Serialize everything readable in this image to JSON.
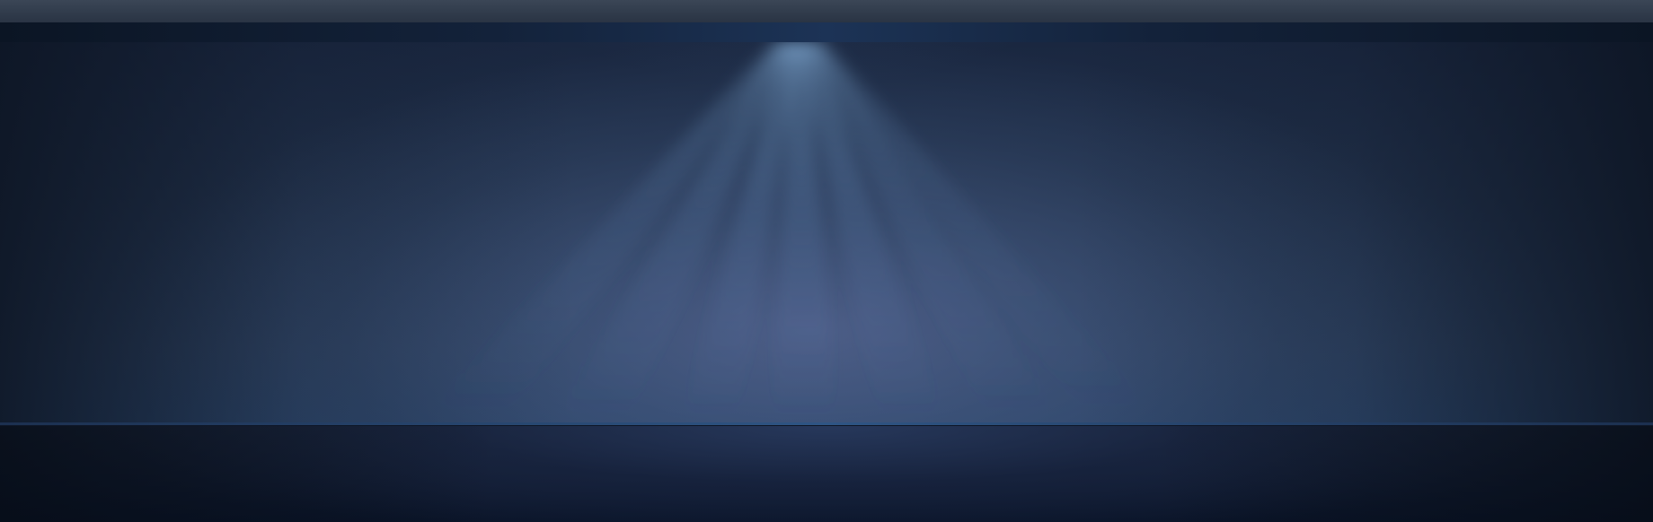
{
  "scene": {
    "name": "spotlight-stage-background",
    "colors": {
      "top_bar": "#333e4e",
      "header_strip": "#13223a",
      "stage_base": "#22324c",
      "spotlight": "#6f9bd0",
      "floor": "#111b30"
    }
  }
}
